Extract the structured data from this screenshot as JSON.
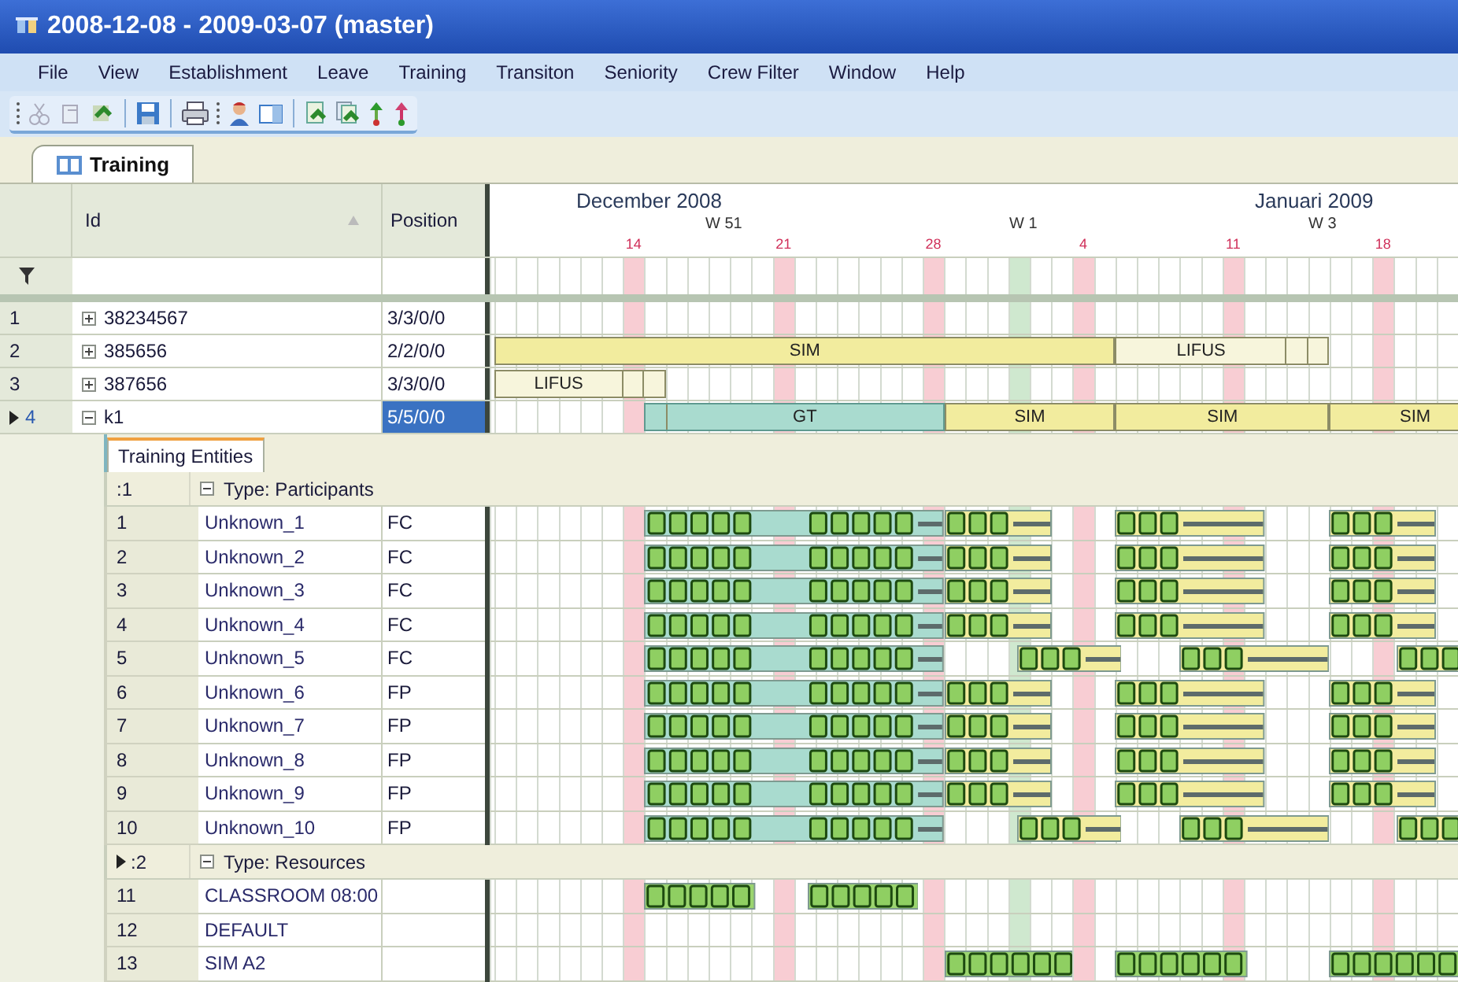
{
  "window": {
    "title": "2008-12-08 - 2009-03-07 (master)"
  },
  "menu": [
    "File",
    "View",
    "Establishment",
    "Leave",
    "Training",
    "Transiton",
    "Seniority",
    "Crew Filter",
    "Window",
    "Help"
  ],
  "tabs": [
    {
      "label": "Training",
      "selected": true
    }
  ],
  "grid": {
    "columns": [
      "Id",
      "Position"
    ]
  },
  "timeline": {
    "months": [
      "December 2008",
      "Januari 2009"
    ],
    "weeks": [
      "W 51",
      "W 1",
      "W 3"
    ],
    "days": [
      "14",
      "21",
      "28",
      "4",
      "11",
      "18"
    ]
  },
  "rows": [
    {
      "number": "1",
      "id": "38234567",
      "position": "3/3/0/0",
      "expanded": false,
      "selected": false,
      "bars": []
    },
    {
      "number": "2",
      "id": "385656",
      "position": "2/2/0/0",
      "expanded": false,
      "selected": false,
      "bars": [
        {
          "label": "SIM",
          "kind": "sim"
        },
        {
          "label": "LIFUS",
          "kind": "lifus"
        }
      ]
    },
    {
      "number": "3",
      "id": "387656",
      "position": "3/3/0/0",
      "expanded": false,
      "selected": false,
      "bars": [
        {
          "label": "LIFUS",
          "kind": "lifus"
        }
      ]
    },
    {
      "number": "4",
      "id": "k1",
      "position": "5/5/0/0",
      "expanded": true,
      "selected": true,
      "bars": [
        {
          "label": "GT",
          "kind": "gt"
        },
        {
          "label": "SIM",
          "kind": "sim"
        },
        {
          "label": "SIM",
          "kind": "sim"
        },
        {
          "label": "SIM",
          "kind": "sim"
        }
      ]
    }
  ],
  "entities": {
    "tab": "Training Entities",
    "groups": [
      {
        "marker": ":1",
        "label": "Type: Participants",
        "expanded": true,
        "selected": false,
        "rows": [
          {
            "number": "1",
            "name": "Unknown_1",
            "position": "FC"
          },
          {
            "number": "2",
            "name": "Unknown_2",
            "position": "FC"
          },
          {
            "number": "3",
            "name": "Unknown_3",
            "position": "FC"
          },
          {
            "number": "4",
            "name": "Unknown_4",
            "position": "FC"
          },
          {
            "number": "5",
            "name": "Unknown_5",
            "position": "FC"
          },
          {
            "number": "6",
            "name": "Unknown_6",
            "position": "FP"
          },
          {
            "number": "7",
            "name": "Unknown_7",
            "position": "FP"
          },
          {
            "number": "8",
            "name": "Unknown_8",
            "position": "FP"
          },
          {
            "number": "9",
            "name": "Unknown_9",
            "position": "FP"
          },
          {
            "number": "10",
            "name": "Unknown_10",
            "position": "FP"
          }
        ]
      },
      {
        "marker": ":2",
        "label": "Type: Resources",
        "expanded": true,
        "selected": true,
        "rows": [
          {
            "number": "11",
            "name": "CLASSROOM 08:00"
          },
          {
            "number": "12",
            "name": "DEFAULT"
          },
          {
            "number": "13",
            "name": "SIM A2"
          }
        ]
      }
    ]
  }
}
